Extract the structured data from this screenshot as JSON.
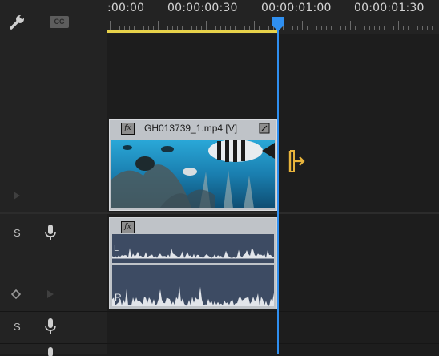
{
  "ruler": {
    "timecodes": [
      ":00:00",
      "00:00:00:30",
      "00:00:01:00",
      "00:00:01:30"
    ]
  },
  "tracks": {
    "video_clip_name": "GH013739_1.mp4 [V]",
    "fx_label": "fx",
    "audio_solo_1": "S",
    "audio_solo_2": "S",
    "channel_left": "L",
    "channel_right": "R"
  },
  "playhead": {
    "time": "00:00:01:00"
  },
  "colors": {
    "playhead": "#2f8ff0",
    "work_area": "#e7d24a",
    "video_clip_bg": "#1e6f96",
    "audio_clip_bg": "#3d4b63",
    "cursor": "#e8b43c"
  }
}
